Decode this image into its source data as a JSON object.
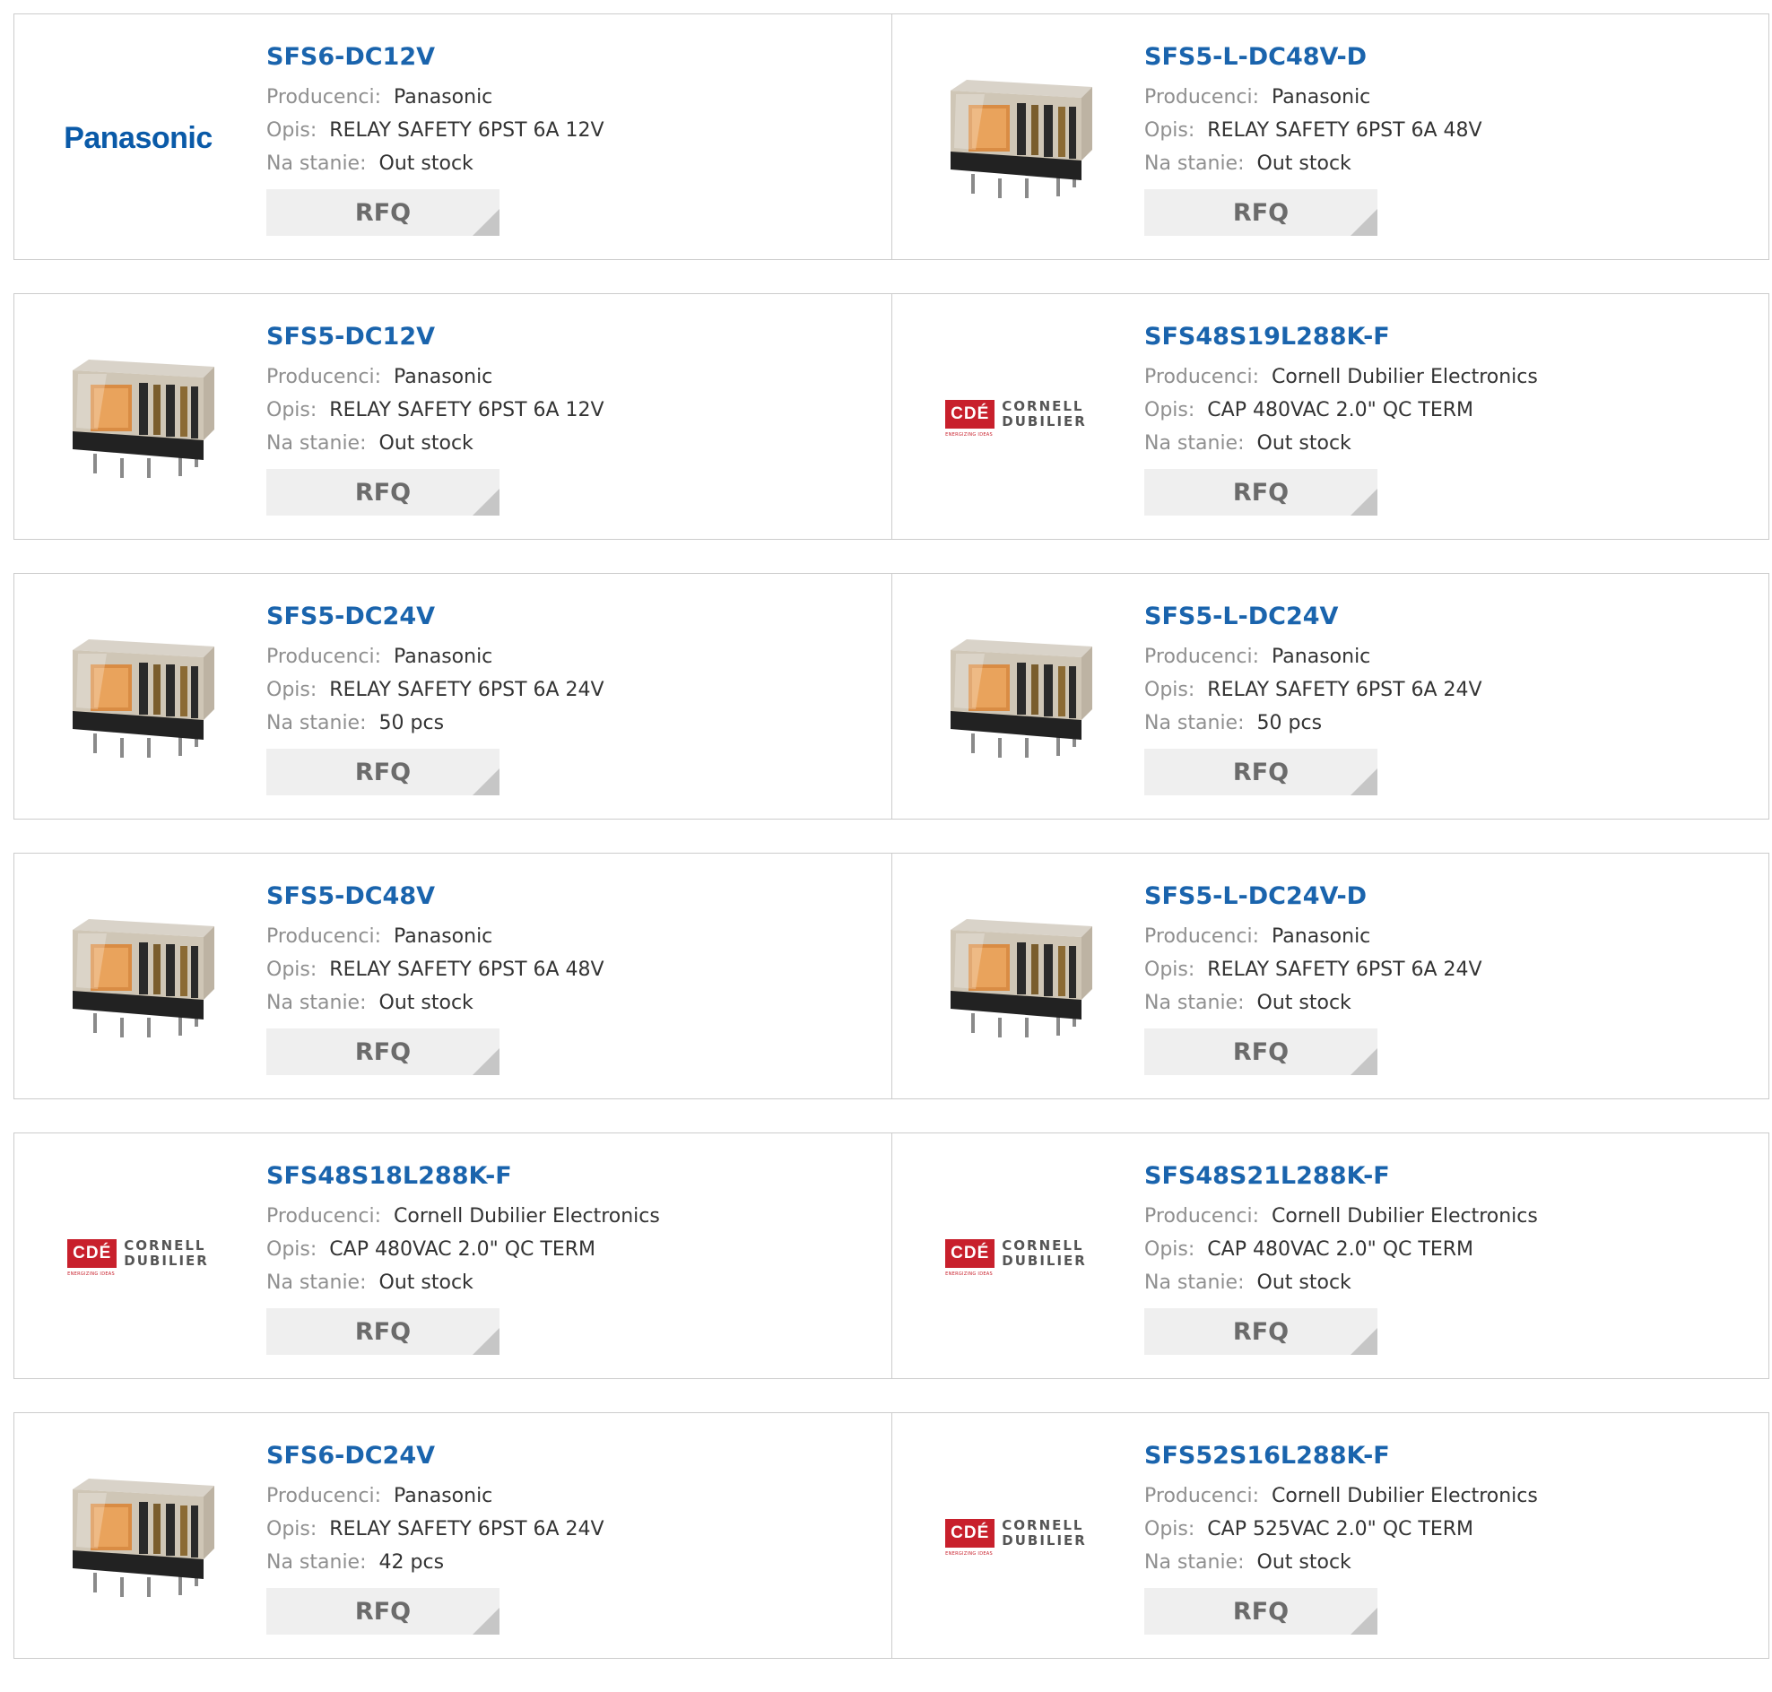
{
  "labels": {
    "manufacturer": "Producenci:",
    "description": "Opis:",
    "stock": "Na stanie:",
    "rfq": "RFQ"
  },
  "colors": {
    "part_link": "#1a64ad",
    "rfq_bg": "#efefef",
    "cde_red": "#c8202c",
    "panasonic_blue": "#0a5aa8"
  },
  "logos": {
    "panasonic": "Panasonic",
    "cde_box": "CDÉ",
    "cde_line1": "CORNELL",
    "cde_line2": "DUBILIER",
    "cde_tag": "ENERGIZING IDEAS"
  },
  "rows": [
    [
      {
        "part": "SFS6-DC12V",
        "image": "panasonic-logo",
        "manufacturer": "Panasonic",
        "description": "RELAY SAFETY 6PST 6A 12V",
        "stock": "Out stock"
      },
      {
        "part": "SFS5-L-DC48V-D",
        "image": "relay-photo",
        "manufacturer": "Panasonic",
        "description": "RELAY SAFETY 6PST 6A 48V",
        "stock": "Out stock"
      }
    ],
    [
      {
        "part": "SFS5-DC12V",
        "image": "relay-photo",
        "manufacturer": "Panasonic",
        "description": "RELAY SAFETY 6PST 6A 12V",
        "stock": "Out stock"
      },
      {
        "part": "SFS48S19L288K-F",
        "image": "cde-logo",
        "manufacturer": "Cornell Dubilier Electronics",
        "description": "CAP 480VAC 2.0\" QC TERM",
        "stock": "Out stock"
      }
    ],
    [
      {
        "part": "SFS5-DC24V",
        "image": "relay-photo",
        "manufacturer": "Panasonic",
        "description": "RELAY SAFETY 6PST 6A 24V",
        "stock": "50 pcs"
      },
      {
        "part": "SFS5-L-DC24V",
        "image": "relay-photo",
        "manufacturer": "Panasonic",
        "description": "RELAY SAFETY 6PST 6A 24V",
        "stock": "50 pcs"
      }
    ],
    [
      {
        "part": "SFS5-DC48V",
        "image": "relay-photo",
        "manufacturer": "Panasonic",
        "description": "RELAY SAFETY 6PST 6A 48V",
        "stock": "Out stock"
      },
      {
        "part": "SFS5-L-DC24V-D",
        "image": "relay-photo",
        "manufacturer": "Panasonic",
        "description": "RELAY SAFETY 6PST 6A 24V",
        "stock": "Out stock"
      }
    ],
    [
      {
        "part": "SFS48S18L288K-F",
        "image": "cde-logo",
        "manufacturer": "Cornell Dubilier Electronics",
        "description": "CAP 480VAC 2.0\" QC TERM",
        "stock": "Out stock"
      },
      {
        "part": "SFS48S21L288K-F",
        "image": "cde-logo",
        "manufacturer": "Cornell Dubilier Electronics",
        "description": "CAP 480VAC 2.0\" QC TERM",
        "stock": "Out stock"
      }
    ],
    [
      {
        "part": "SFS6-DC24V",
        "image": "relay-photo",
        "manufacturer": "Panasonic",
        "description": "RELAY SAFETY 6PST 6A 24V",
        "stock": "42 pcs"
      },
      {
        "part": "SFS52S16L288K-F",
        "image": "cde-logo",
        "manufacturer": "Cornell Dubilier Electronics",
        "description": "CAP 525VAC 2.0\" QC TERM",
        "stock": "Out stock"
      }
    ]
  ]
}
